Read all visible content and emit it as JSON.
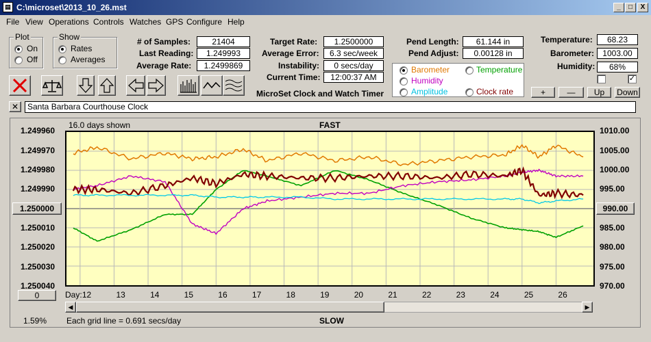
{
  "window": {
    "title": "C:\\microset\\2013_10_26.mst",
    "app_icon": "app-icon",
    "buttons": {
      "minimize": "_",
      "maximize": "□",
      "close": "X"
    }
  },
  "menu": [
    "File",
    "View",
    "Operations",
    "Controls",
    "Watches",
    "GPS",
    "Configure",
    "Help"
  ],
  "plot_group": {
    "title": "Plot",
    "options": [
      "On",
      "Off"
    ],
    "selected": "On"
  },
  "show_group": {
    "title": "Show",
    "options": [
      "Rates",
      "Averages"
    ],
    "selected": "Rates"
  },
  "stats": {
    "samples_label": "# of Samples:",
    "samples": "21404",
    "last_reading_label": "Last Reading:",
    "last_reading": "1.249993",
    "average_rate_label": "Average Rate:",
    "average_rate": "1.2499869",
    "target_rate_label": "Target Rate:",
    "target_rate": "1.2500000",
    "average_error_label": "Average Error:",
    "average_error": "6.3 sec/week",
    "instability_label": "Instability:",
    "instability": "0 secs/day",
    "current_time_label": "Current Time:",
    "current_time": "12:00:37 AM",
    "pend_length_label": "Pend Length:",
    "pend_length": "61.144 in",
    "pend_adjust_label": "Pend Adjust:",
    "pend_adjust": "0.00128 in",
    "temperature_label": "Temperature:",
    "temperature": "68.23",
    "barometer_label": "Barometer:",
    "barometer": "1003.00",
    "humidity_label": "Humidity:",
    "humidity": "68%"
  },
  "app_caption": "MicroSet Clock and Watch Timer",
  "series_selector": [
    {
      "label": "Barometer",
      "color": "#e07800",
      "selected": true
    },
    {
      "label": "Temperature",
      "color": "#00a000",
      "selected": false
    },
    {
      "label": "Humidity",
      "color": "#c000c0",
      "selected": false
    },
    {
      "label": "Clock rate",
      "color": "#800000",
      "selected": false
    },
    {
      "label": "Amplitude",
      "color": "#00c0e0",
      "selected": false
    }
  ],
  "env_buttons": [
    "+",
    "—",
    "Up",
    "Down"
  ],
  "toolbar_icons": [
    "delete-x-icon",
    "balance-scale-icon",
    "arrow-down-icon",
    "arrow-up-icon",
    "arrow-left-icon",
    "arrow-right-icon",
    "bar-histogram-icon",
    "line-wave-icon",
    "multi-wave-icon"
  ],
  "clock_name": "Santa Barbara Courthouse Clock",
  "chart": {
    "days_shown": "16.0 days shown",
    "top_label": "FAST",
    "bottom_label": "SLOW",
    "day_label": "Day:",
    "grid_note": "Each grid line = 0.691 secs/day",
    "percent": "1.59%",
    "left_ticks": [
      "1.249960",
      "1.249970",
      "1.249980",
      "1.249990",
      "1.250000",
      "1.250010",
      "1.250020",
      "1.250030",
      "1.250040"
    ],
    "right_ticks": [
      "1010.00",
      "1005.00",
      "1000.00",
      "995.00",
      "990.00",
      "985.00",
      "980.00",
      "975.00",
      "970.00"
    ],
    "left_center_button": "1.250000",
    "right_center_button": "990.00",
    "left_scroll_value": "0",
    "days": [
      "12",
      "13",
      "14",
      "15",
      "16",
      "17",
      "18",
      "19",
      "20",
      "21",
      "22",
      "23",
      "24",
      "25",
      "26"
    ]
  },
  "chart_data": {
    "type": "line",
    "x": [
      11.8,
      12.5,
      13.5,
      14.5,
      15.3,
      16.0,
      16.8,
      17.5,
      18.5,
      19.5,
      20.5,
      21.5,
      22.5,
      23.5,
      24.5,
      25.0,
      25.5,
      26.0,
      26.8
    ],
    "series": [
      {
        "name": "Barometer",
        "axis": "right",
        "color": "#e07800",
        "values": [
          1004.5,
          1006.0,
          1003.0,
          1004.5,
          1003.0,
          1003.5,
          1005.5,
          1002.5,
          1004.5,
          1002.5,
          1003.5,
          1001.5,
          1002.5,
          1003.5,
          1004.0,
          1006.5,
          1003.5,
          1006.5,
          1003.5
        ]
      },
      {
        "name": "Temperature",
        "axis": "left",
        "color": "#00a000",
        "values": [
          1.25001,
          1.250017,
          1.250011,
          1.250003,
          1.250003,
          1.24999,
          1.24998,
          1.249983,
          1.249988,
          1.24998,
          1.249985,
          1.249992,
          1.249998,
          1.250005,
          1.25001,
          1.250011,
          1.250012,
          1.250015,
          1.250009
        ]
      },
      {
        "name": "Humidity",
        "axis": "left",
        "color": "#c000c0",
        "values": [
          1.24999,
          1.249988,
          1.249983,
          1.249986,
          1.250008,
          1.250013,
          1.25,
          1.249996,
          1.249994,
          1.249992,
          1.249992,
          1.249988,
          1.249986,
          1.249985,
          1.249983,
          1.249981,
          1.24998,
          1.249983,
          1.249983
        ]
      },
      {
        "name": "Clock rate",
        "axis": "left",
        "color": "#800000",
        "values": [
          1.24999,
          1.24999,
          1.249992,
          1.249988,
          1.249984,
          1.249987,
          1.249982,
          1.249983,
          1.249984,
          1.249984,
          1.249983,
          1.249983,
          1.249984,
          1.249982,
          1.249983,
          1.24998,
          1.249993,
          1.249992,
          1.249993
        ]
      },
      {
        "name": "Amplitude",
        "axis": "left",
        "color": "#00c8e8",
        "values": [
          1.249993,
          1.249993,
          1.249993,
          1.249993,
          1.249993,
          1.249994,
          1.249994,
          1.249994,
          1.249994,
          1.249995,
          1.249995,
          1.249995,
          1.249995,
          1.249995,
          1.249995,
          1.249995,
          1.249997,
          1.249996,
          1.249995
        ]
      }
    ],
    "xlim": [
      11.6,
      27.1
    ],
    "ylim_left": [
      1.24996,
      1.25004
    ],
    "ylim_right": [
      970.0,
      1010.0
    ],
    "left_axis_inverted": true,
    "grid": true
  }
}
